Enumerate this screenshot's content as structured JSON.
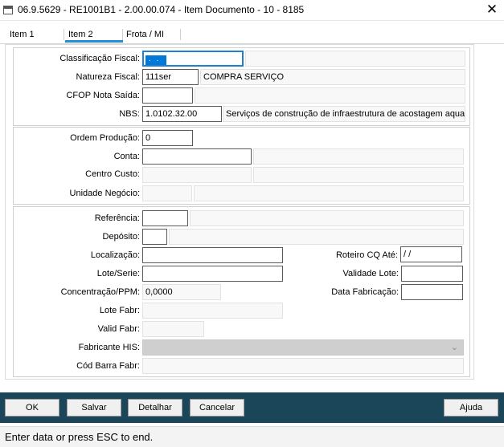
{
  "window": {
    "title": "06.9.5629 - RE1001B1 - 2.00.00.074 - Item Documento - 10 - 8185",
    "close_symbol": "✕"
  },
  "tabs": [
    {
      "label": "Item 1"
    },
    {
      "label": "Item 2",
      "active": true
    },
    {
      "label": "Frota / MI"
    }
  ],
  "fiscal": {
    "classificacao_label": "Classificação Fiscal:",
    "classificacao_mask": ". .",
    "classificacao_desc": "",
    "natureza_label": "Natureza Fiscal:",
    "natureza_value": "111ser",
    "natureza_desc": "COMPRA SERVIÇO",
    "cfop_label": "CFOP Nota Saída:",
    "cfop_value": "",
    "cfop_desc": "",
    "nbs_label": "NBS:",
    "nbs_value": "1.0102.32.00",
    "nbs_desc": "Serviços de construção de infraestrutura de acostagem aquaviá"
  },
  "production": {
    "ordem_label": "Ordem Produção:",
    "ordem_value": "0",
    "conta_label": "Conta:",
    "conta_value": "",
    "centro_label": "Centro Custo:",
    "centro_value": "",
    "unidade_label": "Unidade Negócio:",
    "unidade_value": ""
  },
  "stock": {
    "referencia_label": "Referência:",
    "referencia_value": "",
    "deposito_label": "Depósito:",
    "deposito_value": "",
    "localizacao_label": "Localização:",
    "localizacao_value": "",
    "roteiro_label": "Roteiro CQ Até:",
    "roteiro_value": " / /",
    "lote_label": "Lote/Serie:",
    "lote_value": "",
    "validade_lote_label": "Validade Lote:",
    "validade_lote_value": "",
    "concentracao_label": "Concentração/PPM:",
    "concentracao_value": "0,0000",
    "data_fabricacao_label": "Data Fabricação:",
    "data_fabricacao_value": "",
    "lote_fabr_label": "Lote Fabr:",
    "lote_fabr_value": "",
    "valid_fabr_label": "Valid Fabr:",
    "valid_fabr_value": "",
    "fabricante_label": "Fabricante HIS:",
    "fabricante_value": "",
    "cod_barra_label": "Cód Barra Fabr:",
    "cod_barra_value": ""
  },
  "buttons": {
    "ok": "OK",
    "salvar": "Salvar",
    "detalhar": "Detalhar",
    "cancelar": "Cancelar",
    "ajuda": "Ajuda"
  },
  "status": {
    "message": "Enter data or press ESC to end."
  },
  "colors": {
    "button_bar": "#1b4659",
    "tab_accent": "#1e8fd8",
    "selection": "#0078d7"
  },
  "icons": {
    "app": "window-app-icon",
    "close": "close-icon",
    "combo": "chevron-down-icon"
  }
}
